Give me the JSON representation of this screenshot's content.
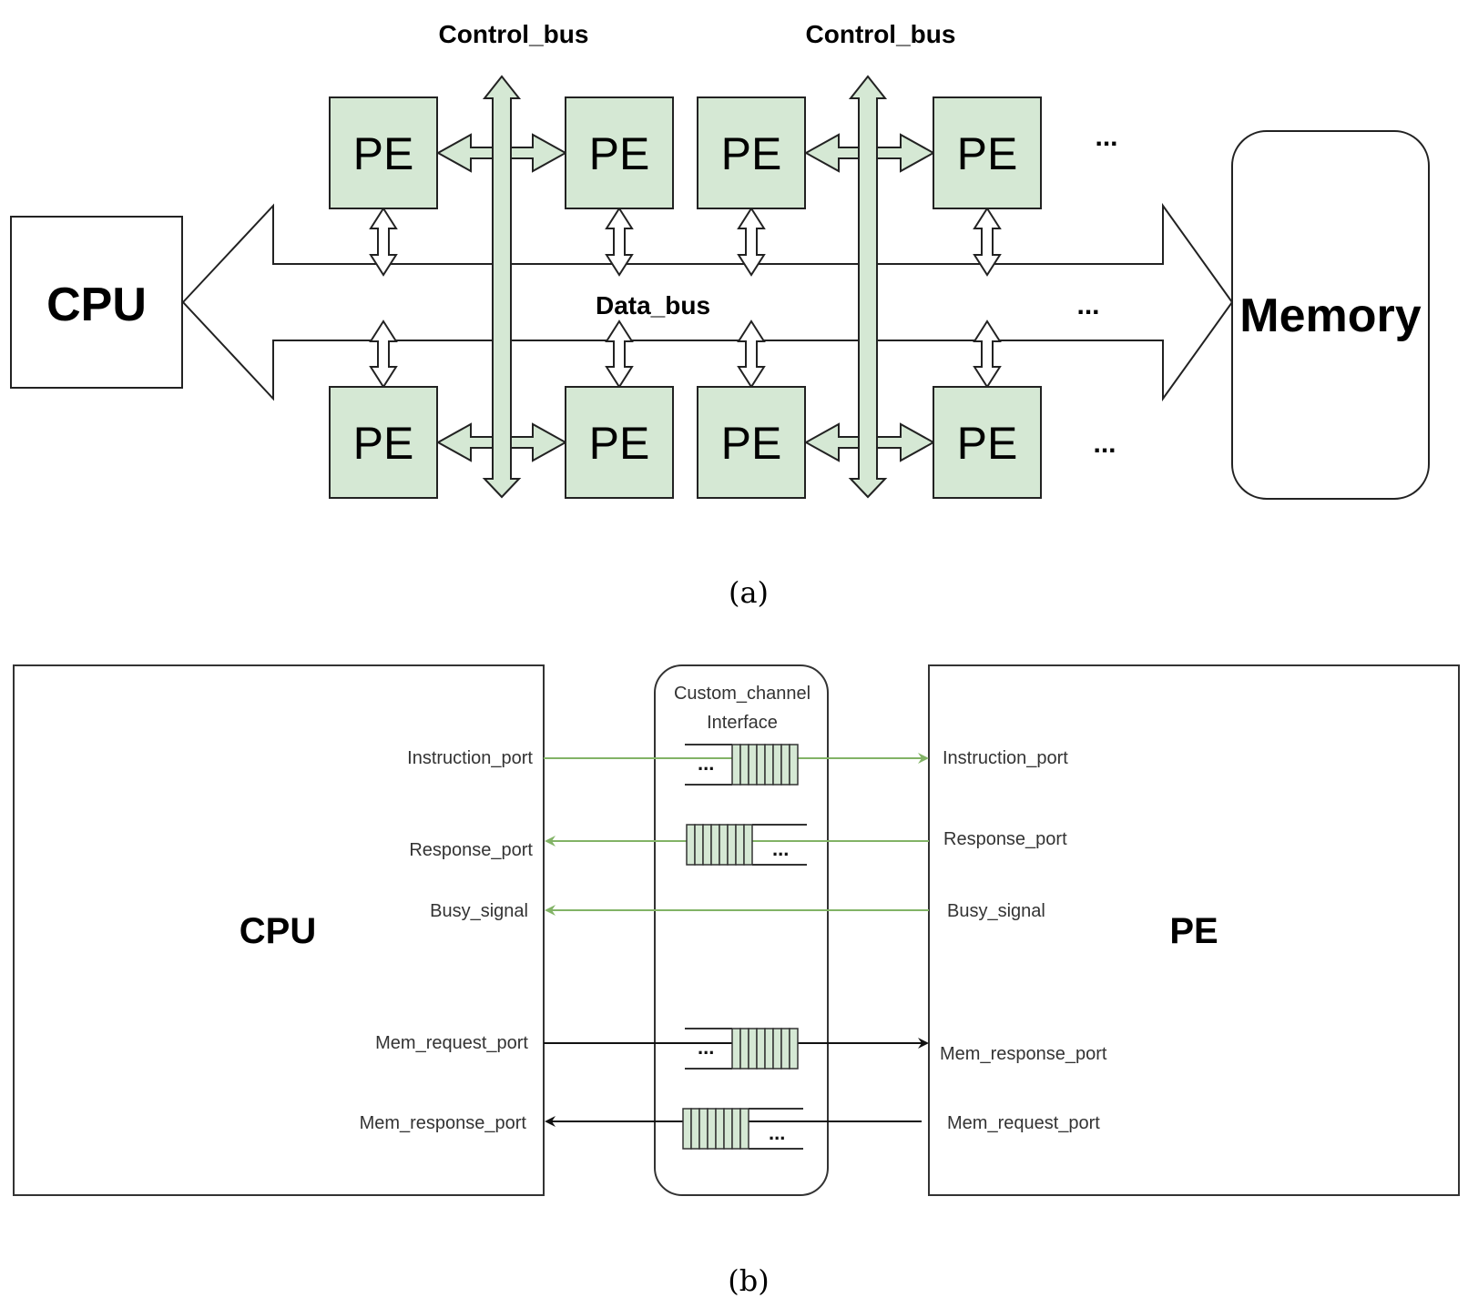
{
  "colors": {
    "pe_fill": "#d5e8d4",
    "stroke": "#222222",
    "green_line": "#82b366",
    "text": "#000000",
    "port_text": "#333333"
  },
  "part_a": {
    "cpu_label": "CPU",
    "memory_label": "Memory",
    "pe_label": "PE",
    "control_bus_labels": [
      "Control_bus",
      "Control_bus"
    ],
    "data_bus_label": "Data_bus",
    "ellipsis": "...",
    "caption": "(a)"
  },
  "part_b": {
    "cpu_label": "CPU",
    "pe_label": "PE",
    "channel_title_line1": "Custom_channel",
    "channel_title_line2": "Interface",
    "ellipsis": "...",
    "caption": "(b)",
    "cpu_ports": [
      "Instruction_port",
      "Response_port",
      "Busy_signal",
      "Mem_request_port",
      "Mem_response_port"
    ],
    "pe_ports": [
      "Instruction_port",
      "Response_port",
      "Busy_signal",
      "Mem_response_port",
      "Mem_request_port"
    ]
  }
}
